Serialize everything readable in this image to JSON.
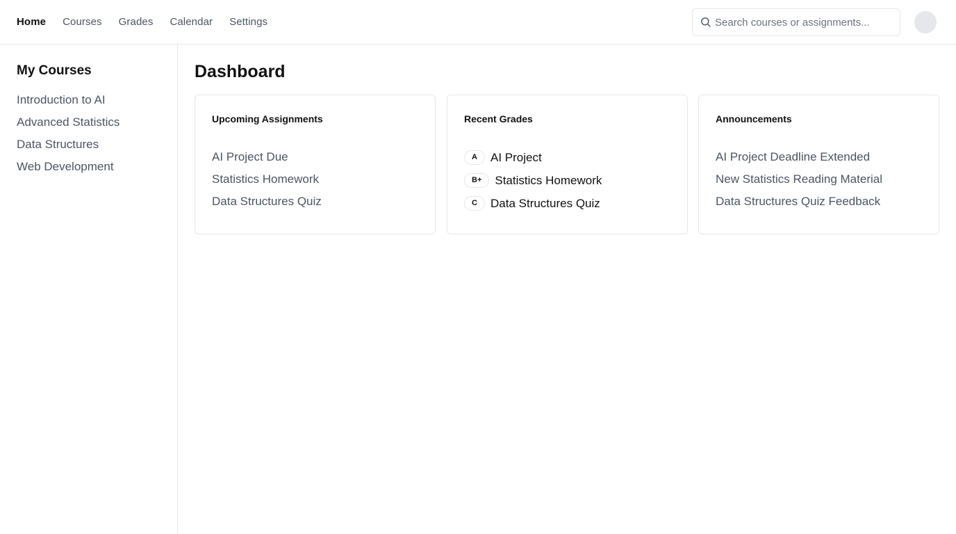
{
  "nav": {
    "items": [
      {
        "label": "Home",
        "active": true
      },
      {
        "label": "Courses",
        "active": false
      },
      {
        "label": "Grades",
        "active": false
      },
      {
        "label": "Calendar",
        "active": false
      },
      {
        "label": "Settings",
        "active": false
      }
    ]
  },
  "search": {
    "placeholder": "Search courses or assignments...",
    "icon": "search-icon"
  },
  "sidebar": {
    "title": "My Courses",
    "items": [
      {
        "label": "Introduction to AI"
      },
      {
        "label": "Advanced Statistics"
      },
      {
        "label": "Data Structures"
      },
      {
        "label": "Web Development"
      }
    ]
  },
  "main": {
    "title": "Dashboard",
    "cards": {
      "upcoming": {
        "title": "Upcoming Assignments",
        "items": [
          "AI Project Due",
          "Statistics Homework",
          "Data Structures Quiz"
        ]
      },
      "grades": {
        "title": "Recent Grades",
        "items": [
          {
            "grade": "A",
            "label": "AI Project"
          },
          {
            "grade": "B+",
            "label": "Statistics Homework"
          },
          {
            "grade": "C",
            "label": "Data Structures Quiz"
          }
        ]
      },
      "announcements": {
        "title": "Announcements",
        "items": [
          "AI Project Deadline Extended",
          "New Statistics Reading Material",
          "Data Structures Quiz Feedback"
        ]
      }
    }
  },
  "colors": {
    "text_primary": "#111111",
    "text_secondary": "#4b5563",
    "border": "#e5e7eb",
    "avatar": "#e5e7eb"
  }
}
